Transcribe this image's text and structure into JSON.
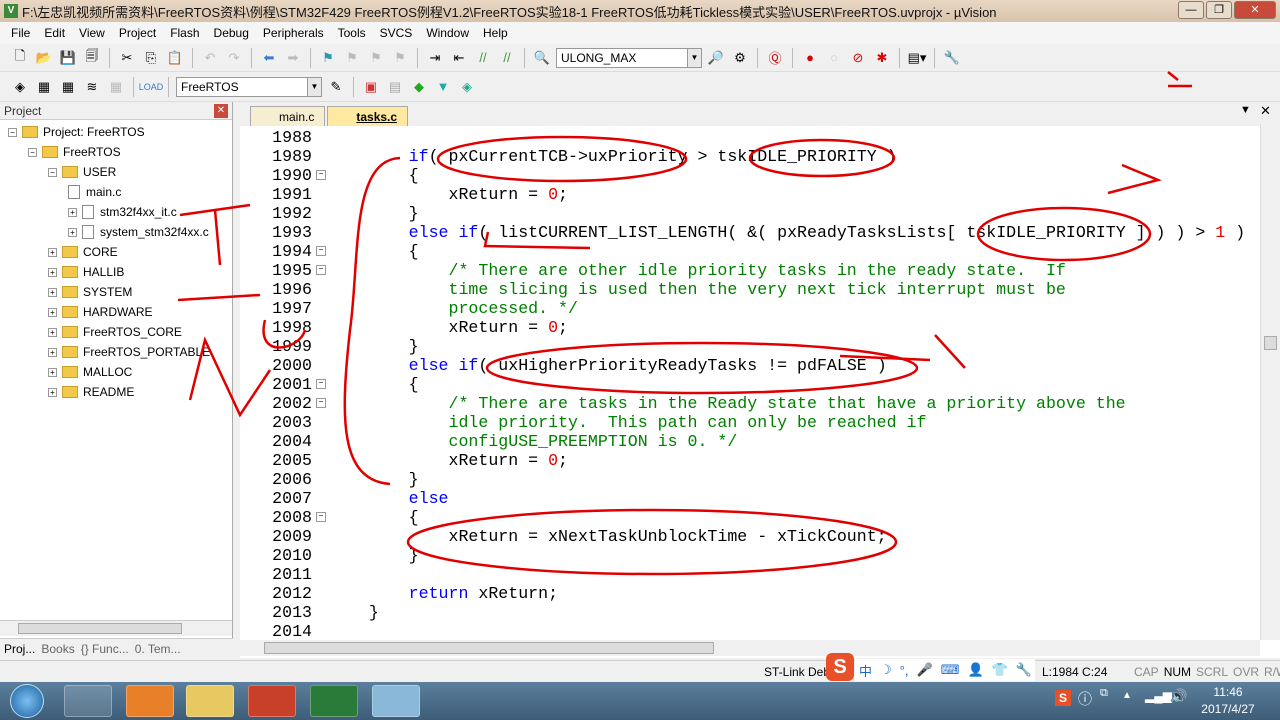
{
  "window": {
    "title": "F:\\左忠凯视频所需资料\\FreeRTOS资料\\例程\\STM32F429 FreeRTOS例程V1.2\\FreeRTOS实验18-1 FreeRTOS低功耗Tickless模式实验\\USER\\FreeRTOS.uvprojx - µVision"
  },
  "menu": [
    "File",
    "Edit",
    "View",
    "Project",
    "Flash",
    "Debug",
    "Peripherals",
    "Tools",
    "SVCS",
    "Window",
    "Help"
  ],
  "toolbar": {
    "find_value": "ULONG_MAX",
    "target_value": "FreeRTOS"
  },
  "project": {
    "header": "Project",
    "root": "Project: FreeRTOS",
    "target": "FreeRTOS",
    "user_group": "USER",
    "user_files": [
      "main.c",
      "stm32f4xx_it.c",
      "system_stm32f4xx.c"
    ],
    "groups": [
      "CORE",
      "HALLIB",
      "SYSTEM",
      "HARDWARE",
      "FreeRTOS_CORE",
      "FreeRTOS_PORTABLE",
      "MALLOC",
      "README"
    ]
  },
  "panel_tabs": [
    "Proj...",
    "Books",
    "{} Func...",
    "0. Tem..."
  ],
  "editor_tabs": [
    {
      "label": "main.c",
      "active": false
    },
    {
      "label": "tasks.c",
      "active": true
    }
  ],
  "code": [
    {
      "n": "1988",
      "t": []
    },
    {
      "n": "1989",
      "t": [
        [
          "",
          "        "
        ],
        [
          "kw",
          "if"
        ],
        [
          "",
          "( pxCurrentTCB->uxPriority > tskIDLE_PRIORITY )"
        ]
      ]
    },
    {
      "n": "1990",
      "f": "-",
      "t": [
        [
          "",
          "        {"
        ]
      ]
    },
    {
      "n": "1991",
      "t": [
        [
          "",
          "            xReturn = "
        ],
        [
          "n",
          "0"
        ],
        [
          "",
          ";"
        ]
      ]
    },
    {
      "n": "1992",
      "t": [
        [
          "",
          "        }"
        ]
      ]
    },
    {
      "n": "1993",
      "t": [
        [
          "",
          "        "
        ],
        [
          "kw",
          "else if"
        ],
        [
          "",
          "( listCURRENT_LIST_LENGTH( &( pxReadyTasksLists[ tskIDLE_PRIORITY ] ) ) > "
        ],
        [
          "n",
          "1"
        ],
        [
          "",
          " )"
        ]
      ]
    },
    {
      "n": "1994",
      "f": "-",
      "t": [
        [
          "",
          "        {"
        ]
      ]
    },
    {
      "n": "1995",
      "f": "-",
      "t": [
        [
          "cm",
          "            /* There are other idle priority tasks in the ready state.  If"
        ]
      ]
    },
    {
      "n": "1996",
      "t": [
        [
          "cm",
          "            time slicing is used then the very next tick interrupt must be"
        ]
      ]
    },
    {
      "n": "1997",
      "t": [
        [
          "cm",
          "            processed. */"
        ]
      ]
    },
    {
      "n": "1998",
      "t": [
        [
          "",
          "            xReturn = "
        ],
        [
          "n",
          "0"
        ],
        [
          "",
          ";"
        ]
      ]
    },
    {
      "n": "1999",
      "t": [
        [
          "",
          "        }"
        ]
      ]
    },
    {
      "n": "2000",
      "t": [
        [
          "",
          "        "
        ],
        [
          "kw",
          "else if"
        ],
        [
          "",
          "( uxHigherPriorityReadyTasks != pdFALSE )"
        ]
      ]
    },
    {
      "n": "2001",
      "f": "-",
      "t": [
        [
          "",
          "        {"
        ]
      ]
    },
    {
      "n": "2002",
      "f": "-",
      "t": [
        [
          "cm",
          "            /* There are tasks in the Ready state that have a priority above the"
        ]
      ]
    },
    {
      "n": "2003",
      "t": [
        [
          "cm",
          "            idle priority.  This path can only be reached if"
        ]
      ]
    },
    {
      "n": "2004",
      "t": [
        [
          "cm",
          "            configUSE_PREEMPTION is 0. */"
        ]
      ]
    },
    {
      "n": "2005",
      "t": [
        [
          "",
          "            xReturn = "
        ],
        [
          "n",
          "0"
        ],
        [
          "",
          ";"
        ]
      ]
    },
    {
      "n": "2006",
      "t": [
        [
          "",
          "        }"
        ]
      ]
    },
    {
      "n": "2007",
      "t": [
        [
          "",
          "        "
        ],
        [
          "kw",
          "else"
        ]
      ]
    },
    {
      "n": "2008",
      "f": "-",
      "t": [
        [
          "",
          "        {"
        ]
      ]
    },
    {
      "n": "2009",
      "t": [
        [
          "",
          "            xReturn = xNextTaskUnblockTime - xTickCount;"
        ]
      ]
    },
    {
      "n": "2010",
      "t": [
        [
          "",
          "        }"
        ]
      ]
    },
    {
      "n": "2011",
      "t": []
    },
    {
      "n": "2012",
      "t": [
        [
          "",
          "        "
        ],
        [
          "kw",
          "return"
        ],
        [
          "",
          " xReturn;"
        ]
      ]
    },
    {
      "n": "2013",
      "t": [
        [
          "",
          "    }"
        ]
      ]
    },
    {
      "n": "2014",
      "t": []
    }
  ],
  "status": {
    "debugger": "ST-Link Debu",
    "ime": "中",
    "position": "L:1984 C:24",
    "flags": [
      "CAP",
      "NUM",
      "SCRL",
      "OVR",
      "R/W"
    ]
  },
  "taskbar": {
    "time": "11:46",
    "date": "2017/4/27"
  },
  "colors": {
    "keyword": "#0000ff",
    "number": "#e00000",
    "comment": "#008000",
    "annotation": "#e00000"
  }
}
